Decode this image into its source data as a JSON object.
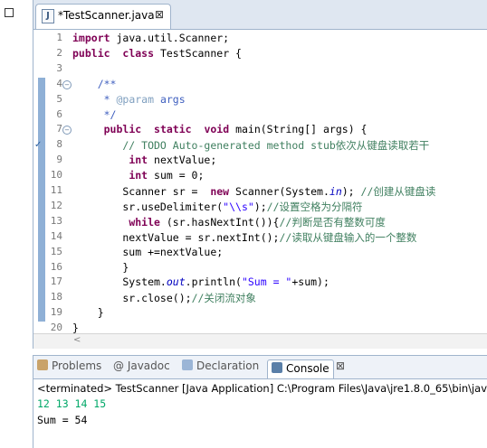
{
  "editor": {
    "tab_label": "*TestScanner.java",
    "tab_close": "⊠",
    "lines": [
      {
        "num": "1",
        "tokens": [
          [
            "k",
            "import"
          ],
          [
            "",
            "java.util.Scanner;"
          ]
        ]
      },
      {
        "num": "2",
        "tokens": [
          [
            "k",
            "public"
          ],
          [
            "",
            ""
          ],
          [
            "k",
            "class"
          ],
          [
            "",
            "TestScanner {"
          ]
        ]
      },
      {
        "num": "3",
        "tokens": []
      },
      {
        "num": "4",
        "tokens": [
          [
            "jd",
            "    /**"
          ]
        ]
      },
      {
        "num": "5",
        "tokens": [
          [
            "jd",
            "     * "
          ],
          [
            "jdt",
            "@param"
          ],
          [
            "jd",
            "args"
          ]
        ]
      },
      {
        "num": "6",
        "tokens": [
          [
            "jd",
            "     */"
          ]
        ]
      },
      {
        "num": "7",
        "tokens": [
          [
            "",
            "    "
          ],
          [
            "k",
            "public"
          ],
          [
            "",
            ""
          ],
          [
            "k",
            "static"
          ],
          [
            "",
            ""
          ],
          [
            "k",
            "void"
          ],
          [
            "",
            "main(String[] args) {"
          ]
        ]
      },
      {
        "num": "8",
        "tokens": [
          [
            "c",
            "        // TODO Auto-generated method stub依次从键盘读取若干"
          ]
        ]
      },
      {
        "num": "9",
        "tokens": [
          [
            "",
            "        "
          ],
          [
            "k",
            "int"
          ],
          [
            "",
            "nextValue;"
          ]
        ]
      },
      {
        "num": "10",
        "tokens": [
          [
            "",
            "        "
          ],
          [
            "k",
            "int"
          ],
          [
            "",
            "sum = 0;"
          ]
        ]
      },
      {
        "num": "11",
        "tokens": [
          [
            "",
            "        Scanner sr = "
          ],
          [
            "k",
            "new"
          ],
          [
            "",
            "Scanner(System."
          ],
          [
            "f",
            "in"
          ],
          [
            "",
            "); "
          ],
          [
            "c",
            "//创建从键盘读"
          ]
        ]
      },
      {
        "num": "12",
        "tokens": [
          [
            "",
            "        sr.useDelimiter("
          ],
          [
            "s",
            "\"\\\\s\""
          ],
          [
            "",
            ");"
          ],
          [
            "c",
            "//设置空格为分隔符"
          ]
        ]
      },
      {
        "num": "13",
        "tokens": [
          [
            "",
            "        "
          ],
          [
            "k",
            "while"
          ],
          [
            "",
            "(sr.hasNextInt()){"
          ],
          [
            "c",
            "//判断是否有整数可度"
          ]
        ]
      },
      {
        "num": "14",
        "tokens": [
          [
            "",
            "        nextValue = sr.nextInt();"
          ],
          [
            "c",
            "//读取从键盘输入的一个整数"
          ]
        ]
      },
      {
        "num": "15",
        "tokens": [
          [
            "",
            "        sum +=nextValue;"
          ]
        ]
      },
      {
        "num": "16",
        "tokens": [
          [
            "",
            "        }"
          ]
        ]
      },
      {
        "num": "17",
        "tokens": [
          [
            "",
            "        System."
          ],
          [
            "f",
            "out"
          ],
          [
            "",
            ".println("
          ],
          [
            "s",
            "\"Sum = \""
          ],
          [
            "",
            "+sum);"
          ]
        ]
      },
      {
        "num": "18",
        "tokens": [
          [
            "",
            "        sr.close();"
          ],
          [
            "c",
            "//关闭流对象"
          ]
        ]
      },
      {
        "num": "19",
        "tokens": [
          [
            "",
            "    }"
          ]
        ]
      },
      {
        "num": "20",
        "tokens": [
          [
            "",
            "}"
          ]
        ]
      }
    ],
    "scroll_arrow": "<"
  },
  "console": {
    "tabs": [
      {
        "label": "Problems",
        "icon": "problems-icon",
        "color": "#c9a36a"
      },
      {
        "label": "@ Javadoc",
        "icon": "javadoc-icon",
        "color": ""
      },
      {
        "label": "Declaration",
        "icon": "declaration-icon",
        "color": "#9bb5d6"
      },
      {
        "label": "Console",
        "icon": "console-icon",
        "color": "#5a7fa8",
        "active": true
      },
      {
        "label": "⊠",
        "icon": "close-icon",
        "color": ""
      }
    ],
    "status": "<terminated> TestScanner [Java Application] C:\\Program Files\\Java\\jre1.8.0_65\\bin\\javaw",
    "input_line": "12 13 14 15",
    "output_line": "Sum = 54"
  },
  "colors": {
    "keyword": "#7f0055",
    "comment": "#3f7f5f",
    "javadoc": "#3f5fbf",
    "string": "#2a00ff",
    "console_input": "#00c87d"
  }
}
